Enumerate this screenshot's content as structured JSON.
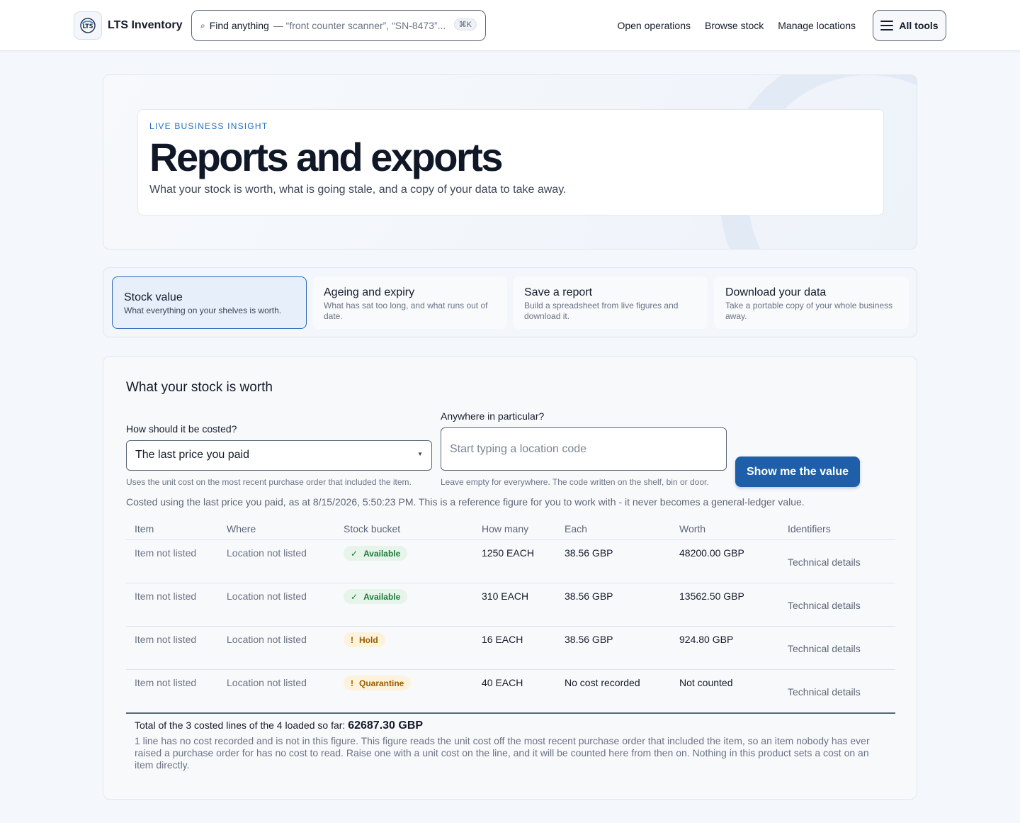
{
  "header": {
    "brand": "LTS Inventory",
    "search": {
      "lead": "Find anything",
      "hint": "— “front counter scanner”, “SN-8473”...",
      "shortcut": "⌘K"
    },
    "nav": [
      "Open operations",
      "Browse stock",
      "Manage locations"
    ],
    "all_tools": "All tools"
  },
  "hero": {
    "eyebrow": "LIVE BUSINESS INSIGHT",
    "title": "Reports and exports",
    "subtitle": "What your stock is worth, what is going stale, and a copy of your data to take away."
  },
  "tabs": [
    {
      "title": "Stock value",
      "desc": "What everything on your shelves is worth.",
      "active": true
    },
    {
      "title": "Ageing and expiry",
      "desc": "What has sat too long, and what runs out of date.",
      "active": false
    },
    {
      "title": "Save a report",
      "desc": "Build a spreadsheet from live figures and download it.",
      "active": false
    },
    {
      "title": "Download your data",
      "desc": "Take a portable copy of your whole business away.",
      "active": false
    }
  ],
  "panel": {
    "title": "What your stock is worth",
    "costing_label": "How should it be costed?",
    "costing_value": "The last price you paid",
    "costing_help": "Uses the unit cost on the most recent purchase order that included the item.",
    "location_label": "Anywhere in particular?",
    "location_placeholder": "Start typing a location code",
    "location_help": "Leave empty for everywhere. The code written on the shelf, bin or door.",
    "button": "Show me the value",
    "note": "Costed using the last price you paid, as at 8/15/2026, 5:50:23 PM. This is a reference figure for you to work with - it never becomes a general-ledger value."
  },
  "table": {
    "headers": [
      "Item",
      "Where",
      "Stock bucket",
      "How many",
      "Each",
      "Worth",
      "Identifiers"
    ],
    "rows": [
      {
        "item": "Item not listed",
        "where": "Location not listed",
        "bucket": "Available",
        "bucket_icon": "✓",
        "how_many": "1250 EACH",
        "each": "38.56 GBP",
        "worth": "48200.00 GBP",
        "ids": "Technical details"
      },
      {
        "item": "Item not listed",
        "where": "Location not listed",
        "bucket": "Available",
        "bucket_icon": "✓",
        "how_many": "310 EACH",
        "each": "38.56 GBP",
        "worth": "13562.50 GBP",
        "ids": "Technical details"
      },
      {
        "item": "Item not listed",
        "where": "Location not listed",
        "bucket": "Hold",
        "bucket_icon": "!",
        "how_many": "16 EACH",
        "each": "38.56 GBP",
        "worth": "924.80 GBP",
        "ids": "Technical details"
      },
      {
        "item": "Item not listed",
        "where": "Location not listed",
        "bucket": "Quarantine",
        "bucket_icon": "!",
        "how_many": "40 EACH",
        "each": "No cost recorded",
        "worth": "Not counted",
        "ids": "Technical details"
      }
    ]
  },
  "total": {
    "label": "Total of the 3 costed lines of the 4 loaded so far:",
    "value": "62687.30 GBP",
    "fine": "1 line has no cost recorded and is not in this figure. This figure reads the unit cost off the most recent purchase order that included the item, so an item nobody has ever raised a purchase order for has no cost to read. Raise one with a unit cost on the line, and it will be counted here from then on. Nothing in this product sets a cost on an item directly."
  },
  "colors": {
    "accent": "#1f5ea8",
    "eyebrow": "#1f6ec2",
    "ok": "#1c7a3a",
    "warn": "#9a5b00"
  }
}
